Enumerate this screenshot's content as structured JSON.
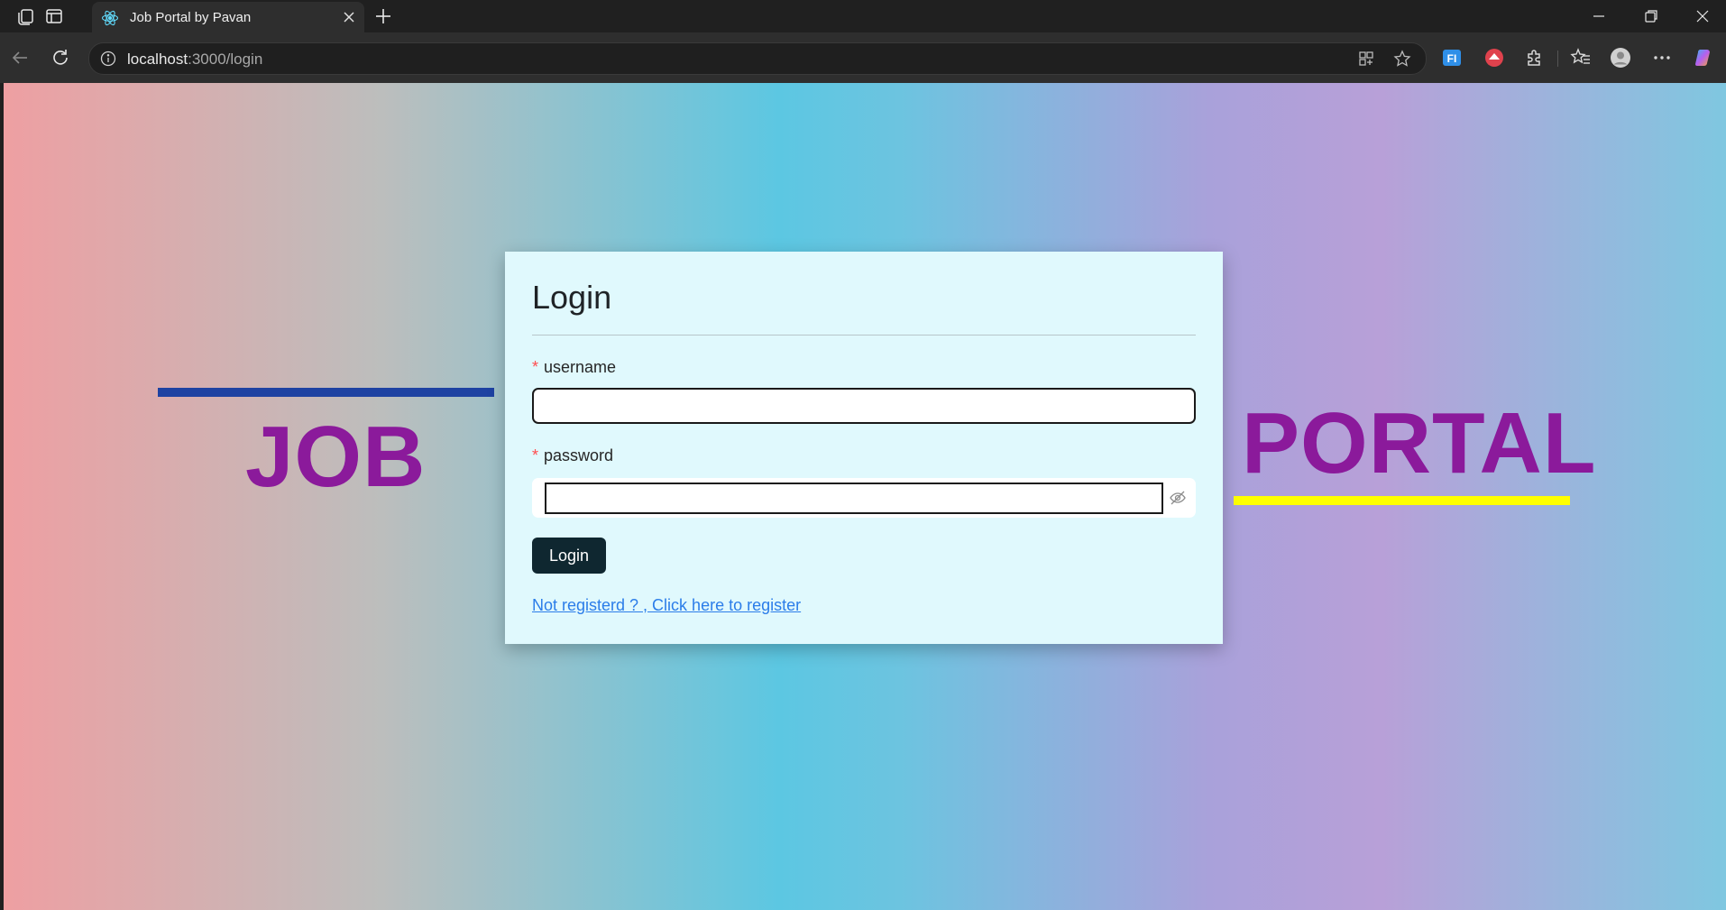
{
  "browser": {
    "tab_title": "Job Portal by Pavan",
    "url_host": "localhost",
    "url_path": ":3000/login"
  },
  "page": {
    "left_word": "JOB",
    "right_word": "PORTAL",
    "colors": {
      "word": "#8b1a9b",
      "left_bar": "#1e42a2",
      "right_bar": "#ffff00",
      "card_bg": "#e0f9fd",
      "button_bg": "#0f2730",
      "link": "#2b7de9"
    }
  },
  "login_form": {
    "title": "Login",
    "username_label": "username",
    "username_value": "",
    "password_label": "password",
    "password_value": "",
    "required_mark": "*",
    "submit_label": "Login",
    "register_link": "Not registerd ? , Click here to register"
  }
}
